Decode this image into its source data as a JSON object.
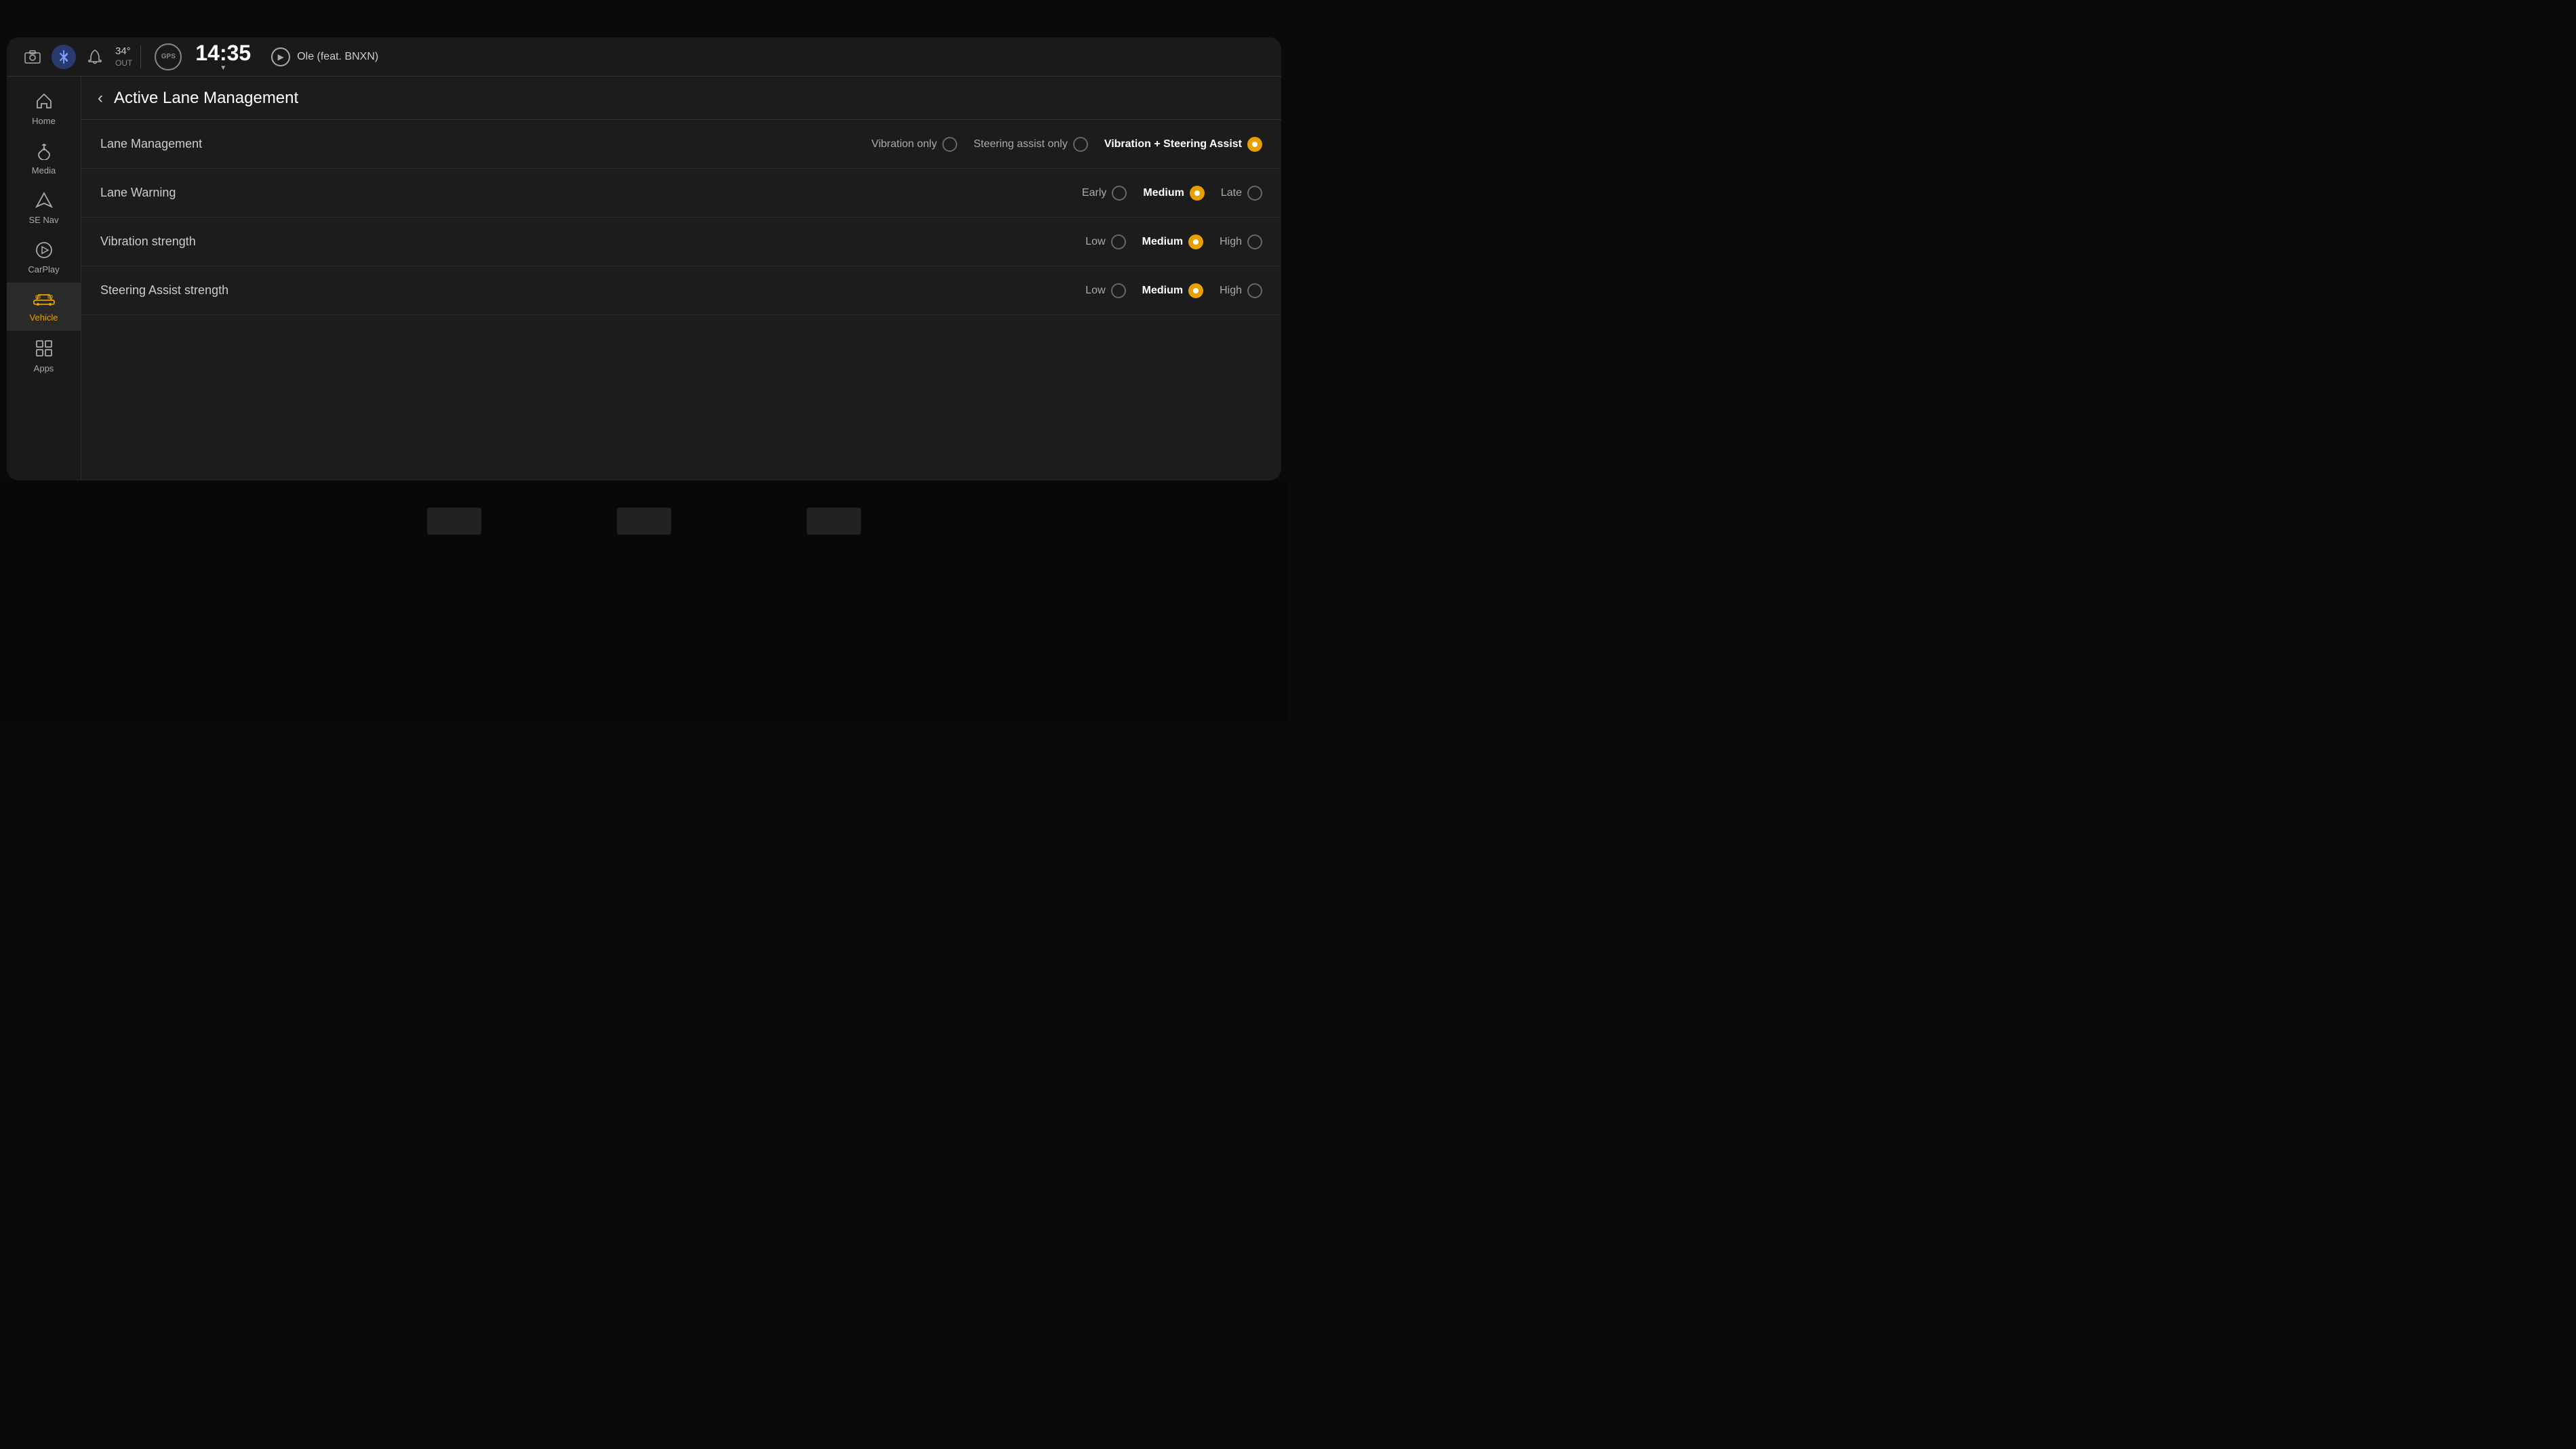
{
  "statusBar": {
    "temperature": "34°",
    "temperatureUnit": "OUT",
    "time": "14:35",
    "mediaPlaying": "Ole (feat. BNXN)",
    "gpsLabel": "GPS"
  },
  "sidebar": {
    "items": [
      {
        "id": "home",
        "label": "Home",
        "icon": "⌂",
        "active": false
      },
      {
        "id": "media",
        "label": "Media",
        "icon": "♪",
        "active": false
      },
      {
        "id": "nav",
        "label": "Nav",
        "icon": "▲",
        "active": false
      },
      {
        "id": "carplay",
        "label": "CarPlay",
        "icon": "▶",
        "active": false
      },
      {
        "id": "vehicle",
        "label": "Vehicle",
        "icon": "🚗",
        "active": true
      },
      {
        "id": "apps",
        "label": "Apps",
        "icon": "⊞",
        "active": false
      }
    ]
  },
  "page": {
    "title": "Active Lane Management",
    "backLabel": "‹"
  },
  "settings": [
    {
      "id": "lane-management",
      "label": "Lane Management",
      "options": [
        {
          "id": "vibration-only",
          "label": "Vibration only",
          "selected": false
        },
        {
          "id": "steering-assist-only",
          "label": "Steering assist only",
          "selected": false
        },
        {
          "id": "vibration-steering",
          "label": "Vibration + Steering Assist",
          "selected": true
        }
      ]
    },
    {
      "id": "lane-warning",
      "label": "Lane Warning",
      "options": [
        {
          "id": "early",
          "label": "Early",
          "selected": false
        },
        {
          "id": "medium",
          "label": "Medium",
          "selected": true
        },
        {
          "id": "late",
          "label": "Late",
          "selected": false
        }
      ]
    },
    {
      "id": "vibration-strength",
      "label": "Vibration strength",
      "options": [
        {
          "id": "low",
          "label": "Low",
          "selected": false
        },
        {
          "id": "medium",
          "label": "Medium",
          "selected": true
        },
        {
          "id": "high",
          "label": "High",
          "selected": false
        }
      ]
    },
    {
      "id": "steering-assist-strength",
      "label": "Steering Assist strength",
      "options": [
        {
          "id": "low",
          "label": "Low",
          "selected": false
        },
        {
          "id": "medium",
          "label": "Medium",
          "selected": true
        },
        {
          "id": "high",
          "label": "High",
          "selected": false
        }
      ]
    }
  ],
  "icons": {
    "camera": "📷",
    "bluetooth": "⬡",
    "bell": "🔔",
    "gps": "GPS",
    "play": "▶",
    "back": "‹"
  }
}
